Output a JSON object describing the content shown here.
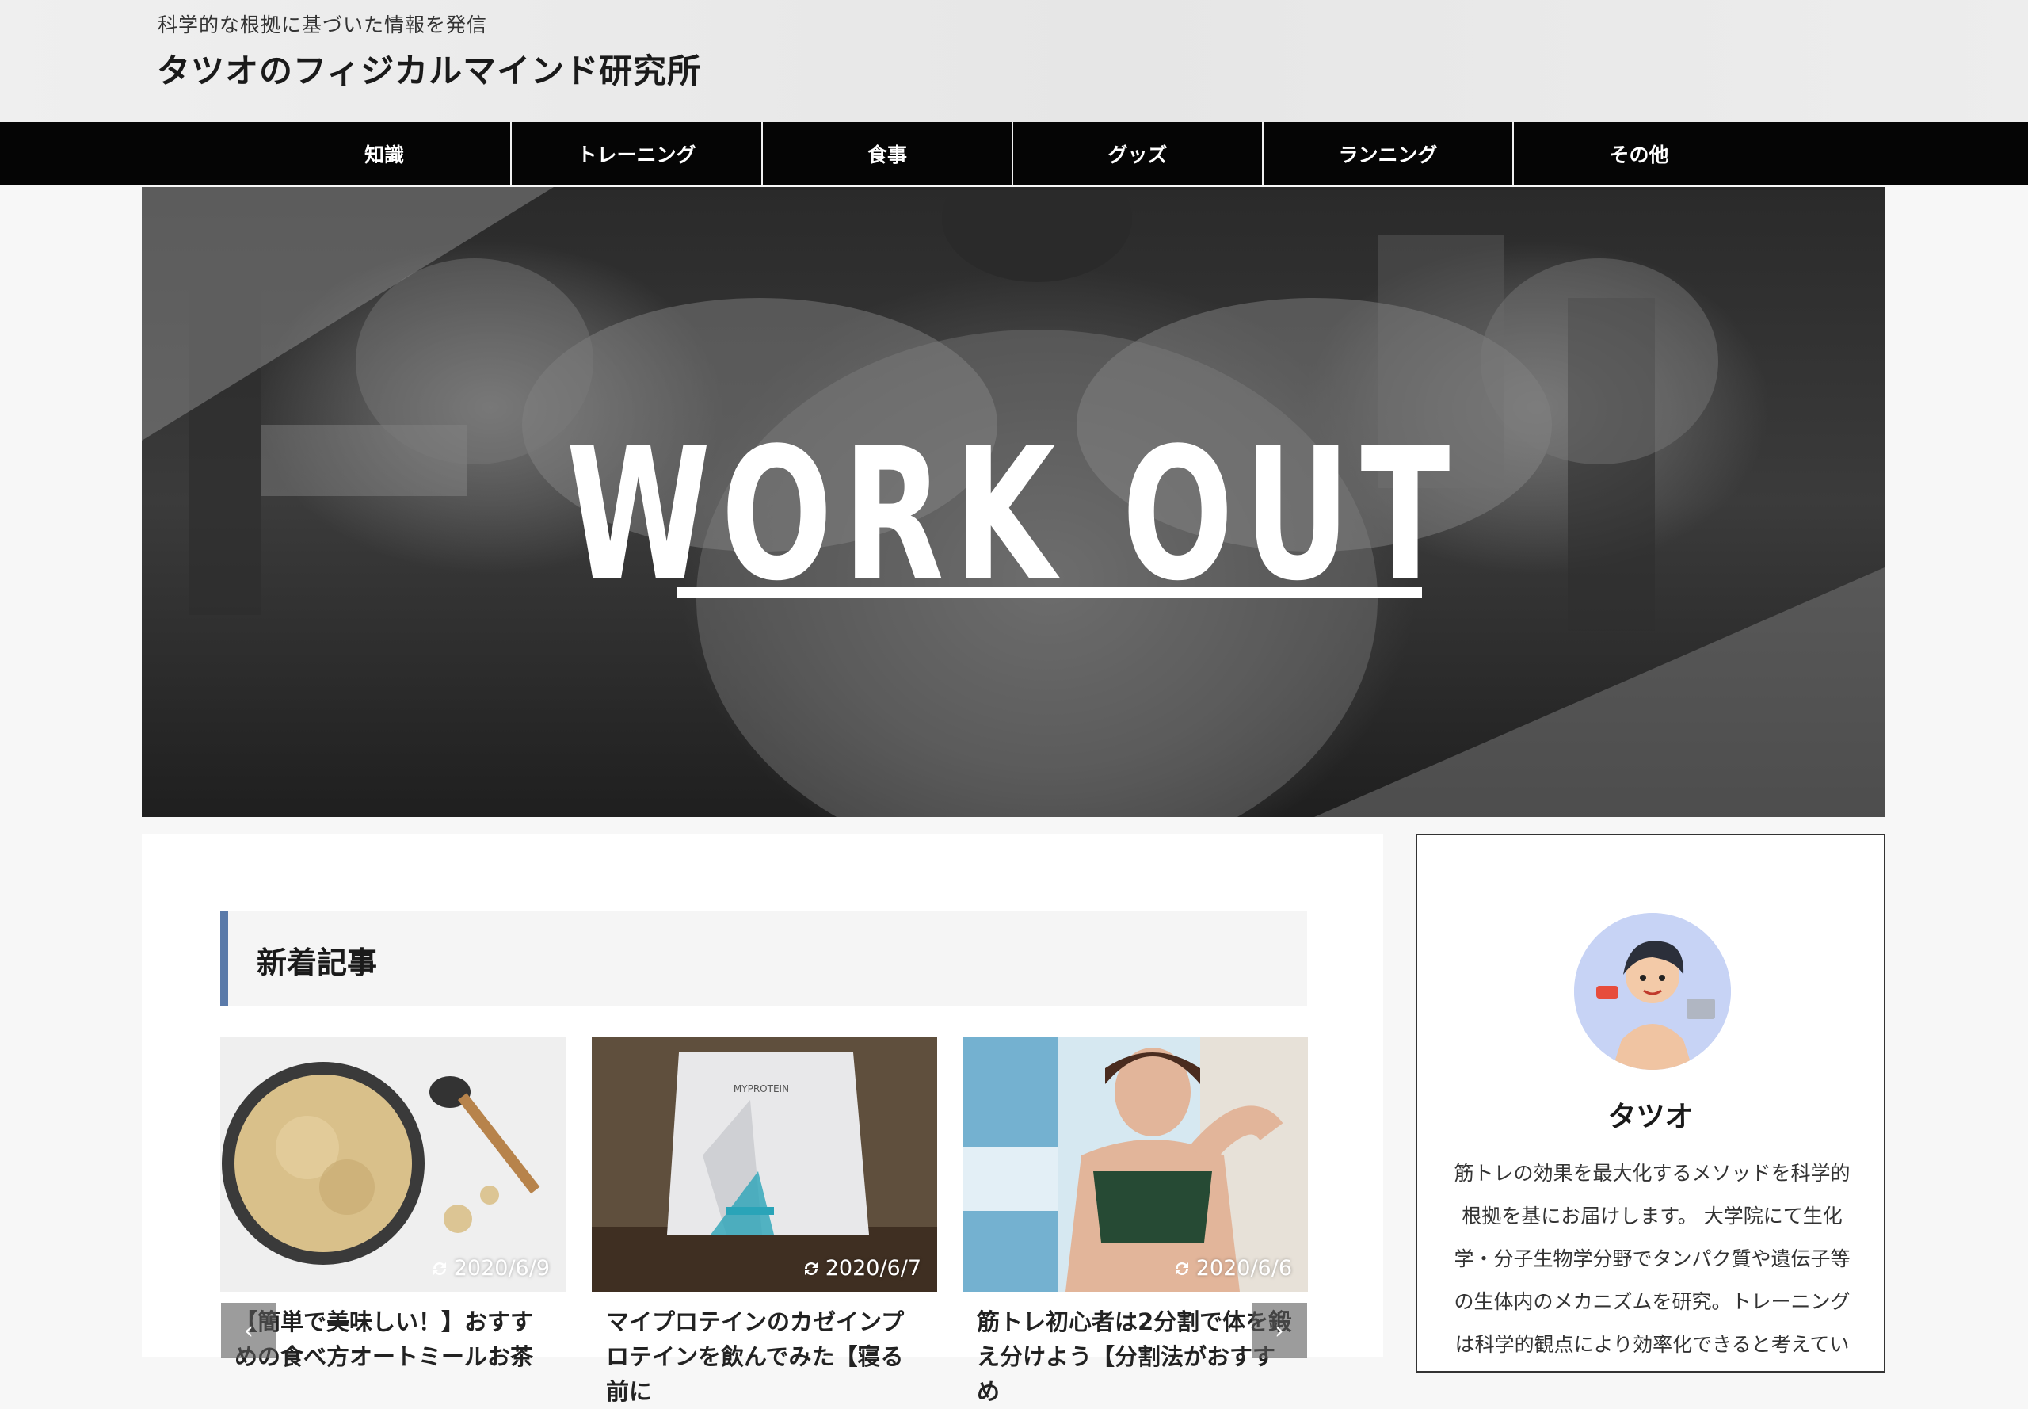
{
  "header": {
    "tagline": "科学的な根拠に基づいた情報を発信",
    "site_title": "タツオのフィジカルマインド研究所"
  },
  "nav": {
    "items": [
      {
        "label": "知識"
      },
      {
        "label": "トレーニング"
      },
      {
        "label": "食事"
      },
      {
        "label": "グッズ"
      },
      {
        "label": "ランニング"
      },
      {
        "label": "その他"
      }
    ]
  },
  "hero": {
    "title": "WORK OUT"
  },
  "main": {
    "section_heading": "新着記事",
    "articles": [
      {
        "date": "2020/6/9",
        "title": "【簡単で美味しい！】おすすめの食べ方オートミールお茶"
      },
      {
        "date": "2020/6/7",
        "title": "マイプロテインのカゼインプロテインを飲んでみた【寝る前に"
      },
      {
        "date": "2020/6/6",
        "title": "筋トレ初心者は2分割で体を鍛え分けよう【分割法がおすすめ"
      }
    ],
    "slider": {
      "prev_icon": "chevron-left-icon",
      "next_icon": "chevron-right-icon"
    }
  },
  "sidebar": {
    "profile": {
      "name": "タツオ",
      "bio": "筋トレの効果を最大化するメソッドを科学的根拠を基にお届けします。 大学院にて生化学・分子生物学分野でタンパク質や遺伝子等の生体内のメカニズムを研究。トレーニングは科学的観点により効率化できると考えてい"
    }
  },
  "colors": {
    "nav_bg": "#050505",
    "heading_accent": "#5a7aa9",
    "avatar_bg": "#c7d3f5"
  }
}
